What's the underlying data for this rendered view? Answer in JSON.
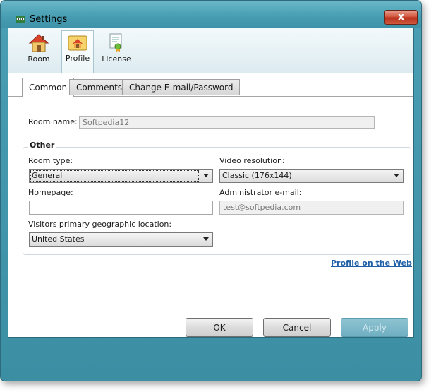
{
  "window": {
    "title": "Settings",
    "close_label": "x"
  },
  "toolbar": {
    "items": [
      {
        "label": "Room",
        "icon": "house-icon"
      },
      {
        "label": "Profile",
        "icon": "profile-icon"
      },
      {
        "label": "License",
        "icon": "certificate-icon"
      }
    ]
  },
  "subtabs": [
    "Common",
    "Comments",
    "Change E-mail/Password"
  ],
  "form": {
    "room_name_label": "Room name:",
    "room_name_value": "Softpedia12",
    "group_title": "Other",
    "room_type_label": "Room type:",
    "room_type_value": "General",
    "video_resolution_label": "Video resolution:",
    "video_resolution_value": "Classic (176x144)",
    "homepage_label": "Homepage:",
    "homepage_value": "",
    "admin_email_label": "Administrator e-mail:",
    "admin_email_value": "test@softpedia.com",
    "location_label": "Visitors primary geographic location:",
    "location_value": "United States",
    "profile_link": "Profile on the Web"
  },
  "buttons": {
    "ok": "OK",
    "cancel": "Cancel",
    "apply": "Apply"
  },
  "colors": {
    "frame": "#4a9fb4",
    "link": "#1f5fa8",
    "close": "#c8402a"
  }
}
